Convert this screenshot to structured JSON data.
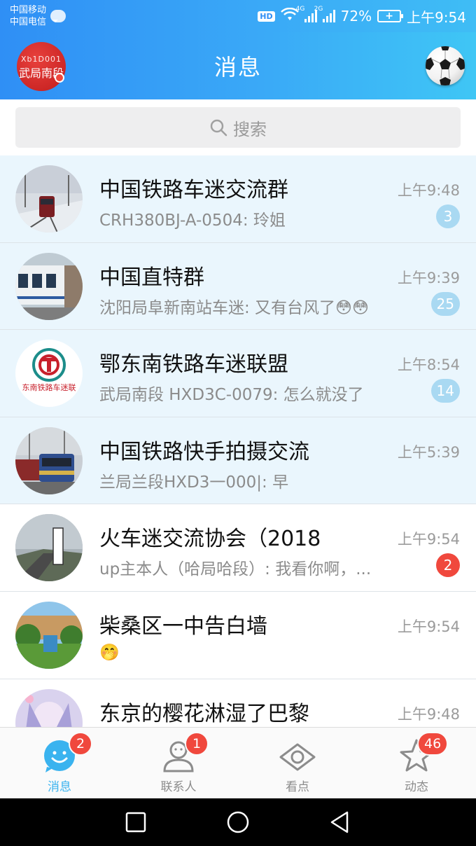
{
  "status_bar": {
    "carrier_1": "中国移动",
    "carrier_2": "中国电信",
    "hd": "HD",
    "net_1": "4G",
    "net_2": "2G",
    "battery": "72%",
    "time": "上午9:54"
  },
  "header": {
    "title": "消息",
    "avatar_line1": "Xb1D001",
    "avatar_line2": "武局南段"
  },
  "search": {
    "placeholder": "搜索"
  },
  "conversations": [
    {
      "name": "中国铁路车迷交流群",
      "message": "CRH380BJ-A-0504: 玲姐",
      "time": "上午9:48",
      "count": "3",
      "pinned": true
    },
    {
      "name": "中国直特群",
      "message": "沈阳局阜新南站车迷: 又有台风了😳😳",
      "time": "上午9:39",
      "count": "25",
      "pinned": true
    },
    {
      "name": "鄂东南铁路车迷联盟",
      "message": "武局南段 HXD3C-0079: 怎么就没了",
      "time": "上午8:54",
      "count": "14",
      "pinned": true
    },
    {
      "name": "中国铁路快手拍摄交流",
      "message": "兰局兰段HXD3一000|: 早",
      "time": "上午5:39",
      "count": "",
      "pinned": true
    },
    {
      "name": "火车迷交流协会（2018",
      "message": "up主本人（哈局哈段）: 我看你啊，...",
      "time": "上午9:54",
      "count": "2",
      "pinned": false
    },
    {
      "name": "柴桑区一中告白墙",
      "message": "🤭",
      "time": "上午9:54",
      "count": "",
      "pinned": false
    },
    {
      "name": "东京的樱花淋湿了巴黎",
      "message": "",
      "time": "上午9:48",
      "count": "",
      "pinned": false
    }
  ],
  "avatar_seals": {
    "row3_text": "东南铁路车迷联"
  },
  "tabs": [
    {
      "label": "消息",
      "badge": "2"
    },
    {
      "label": "联系人",
      "badge": "1"
    },
    {
      "label": "看点",
      "badge": ""
    },
    {
      "label": "动态",
      "badge": "46"
    }
  ],
  "colors": {
    "accent": "#3ab3ef",
    "badge_red": "#f0483d",
    "badge_blue": "#a9d9f2",
    "pinned_bg": "#eaf6fd"
  }
}
